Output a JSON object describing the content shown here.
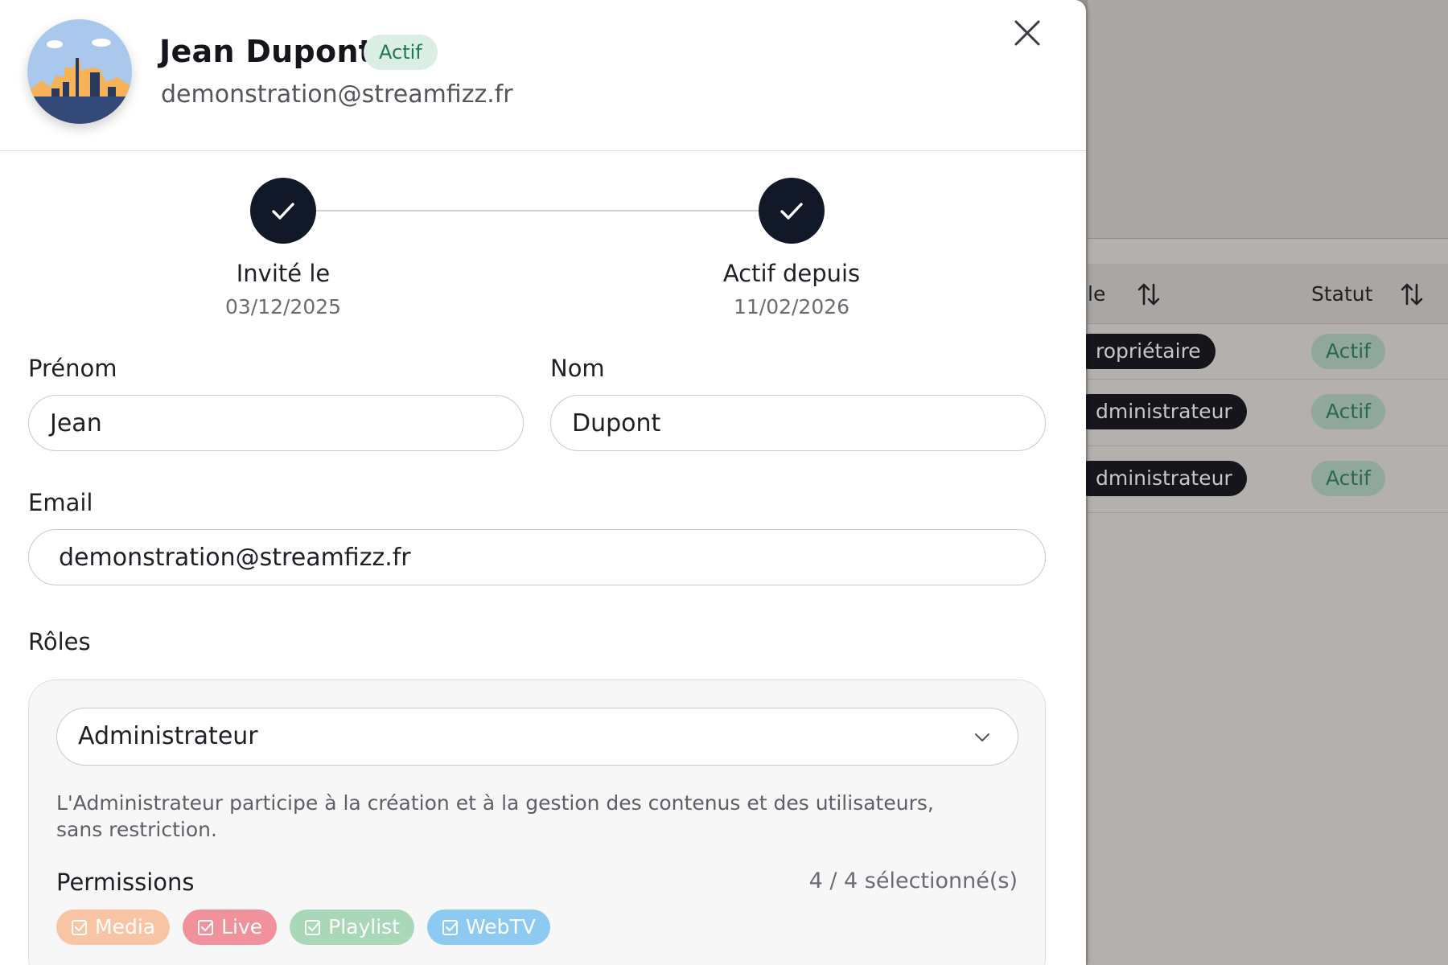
{
  "user": {
    "name": "Jean Dupont",
    "status": "Actif",
    "email": "demonstration@streamfizz.fr"
  },
  "steps": [
    {
      "label": "Invité le",
      "date": "03/12/2025"
    },
    {
      "label": "Actif depuis",
      "date": "11/02/2026"
    }
  ],
  "form": {
    "first_name_label": "Prénom",
    "first_name_value": "Jean",
    "last_name_label": "Nom",
    "last_name_value": "Dupont",
    "email_label": "Email",
    "email_value": "demonstration@streamfizz.fr",
    "roles_label": "Rôles",
    "role_selected": "Administrateur",
    "role_description": "L'Administrateur participe à la création et à la gestion des contenus et des utilisateurs, sans restriction.",
    "permissions_label": "Permissions",
    "permissions_count": "4 / 4 sélectionné(s)",
    "permissions": [
      {
        "label": "Media",
        "color": "#f9c4a4"
      },
      {
        "label": "Live",
        "color": "#f0919c"
      },
      {
        "label": "Playlist",
        "color": "#a9d8b8"
      },
      {
        "label": "WebTV",
        "color": "#8ccaf1"
      }
    ]
  },
  "background_table": {
    "headers": {
      "role": "le",
      "status": "Statut"
    },
    "rows": [
      {
        "role": "ropriétaire",
        "status": "Actif"
      },
      {
        "role": "dministrateur",
        "status": "Actif"
      },
      {
        "role": "dministrateur",
        "status": "Actif"
      }
    ]
  },
  "colors": {
    "step_dark": "#111827",
    "badge_bg": "#dbeee3",
    "badge_text": "#1f7a4f"
  }
}
